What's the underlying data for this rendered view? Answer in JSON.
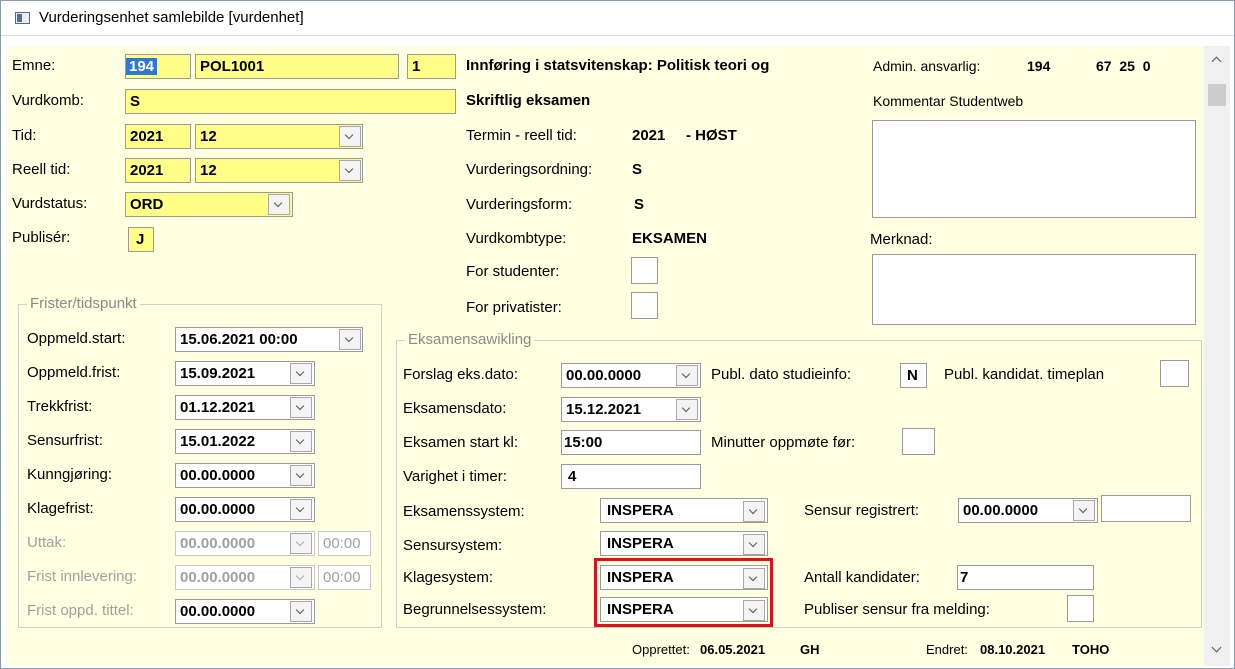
{
  "window": {
    "title": "Vurderingsenhet samlebilde [vurdenhet]"
  },
  "left": {
    "emne_label": "Emne:",
    "emne_inst": "194",
    "emne_kode": "POL1001",
    "emne_versjon": "1",
    "vurdkomb_label": "Vurdkomb:",
    "vurdkomb_value": "S",
    "tid_label": "Tid:",
    "tid_year": "2021",
    "tid_period": "12",
    "reell_tid_label": "Reell tid:",
    "reell_year": "2021",
    "reell_period": "12",
    "vurdstatus_label": "Vurdstatus:",
    "vurdstatus_value": "ORD",
    "publiser_label": "Publisér:",
    "publiser_value": "J"
  },
  "middle": {
    "emne_navn": "Innføring i statsvitenskap: Politisk teori og",
    "vurdkomb_navn": "Skriftlig eksamen",
    "termin_label": "Termin - reell tid:",
    "termin_year": "2021",
    "termin_value": "- HØST",
    "vurderingsordning_label": "Vurderingsordning:",
    "vurderingsordning_value": "S",
    "vurderingsform_label": "Vurderingsform:",
    "vurderingsform_value": "S",
    "vurdkombtype_label": "Vurdkombtype:",
    "vurdkombtype_value": "EKSAMEN",
    "for_studenter_label": "For studenter:",
    "for_privatister_label": "For privatister:"
  },
  "right": {
    "admin_label": "Admin. ansvarlig:",
    "admin_value": "194",
    "admin_codes": "67  25  0",
    "kommentar_label": "Kommentar Studentweb",
    "merknad_label": "Merknad:"
  },
  "frister": {
    "title": "Frister/tidspunkt",
    "rows": [
      {
        "label": "Oppmeld.start:",
        "value": "15.06.2021 00:00"
      },
      {
        "label": "Oppmeld.frist:",
        "value": "15.09.2021"
      },
      {
        "label": "Trekkfrist:",
        "value": "01.12.2021"
      },
      {
        "label": "Sensurfrist:",
        "value": "15.01.2022"
      },
      {
        "label": "Kunngjøring:",
        "value": "00.00.0000"
      },
      {
        "label": "Klagefrist:",
        "value": "00.00.0000"
      },
      {
        "label": "Uttak:",
        "value": "00.00.0000",
        "time": "00:00"
      },
      {
        "label": "Frist innlevering:",
        "value": "00.00.0000",
        "time": "00:00"
      },
      {
        "label": "Frist oppd. tittel:",
        "value": "00.00.0000"
      }
    ]
  },
  "eksamen": {
    "title": "Eksamensawikling",
    "forslag_label": "Forslag eks.dato:",
    "forslag_value": "00.00.0000",
    "publ_dato_label": "Publ. dato studieinfo:",
    "publ_dato_value": "N",
    "publ_kandidat_label": "Publ. kandidat. timeplan",
    "eksamensdato_label": "Eksamensdato:",
    "eksamensdato_value": "15.12.2021",
    "start_label": "Eksamen start kl:",
    "start_value": "15:00",
    "minutter_label": "Minutter oppmøte før:",
    "varighet_label": "Varighet i timer:",
    "varighet_value": "4",
    "eksamenssystem_label": "Eksamenssystem:",
    "eksamenssystem_value": "INSPERA",
    "sensur_reg_label": "Sensur registrert:",
    "sensur_reg_value": "00.00.0000",
    "sensursystem_label": "Sensursystem:",
    "sensursystem_value": "INSPERA",
    "klagesystem_label": "Klagesystem:",
    "klagesystem_value": "INSPERA",
    "antall_label": "Antall kandidater:",
    "antall_value": "7",
    "begrunnelse_label": "Begrunnelsessystem:",
    "begrunnelse_value": "INSPERA",
    "publiser_sensur_label": "Publiser sensur fra melding:"
  },
  "footer": {
    "opprettet_label": "Opprettet:",
    "opprettet_date": "06.05.2021",
    "opprettet_user": "GH",
    "endret_label": "Endret:",
    "endret_date": "08.10.2021",
    "endret_user": "TOHO"
  },
  "colors": {
    "field_yellow": "#ffff88",
    "form_bg": "#ffffe1",
    "highlight": "#e0101a",
    "selection": "#3078d8"
  }
}
